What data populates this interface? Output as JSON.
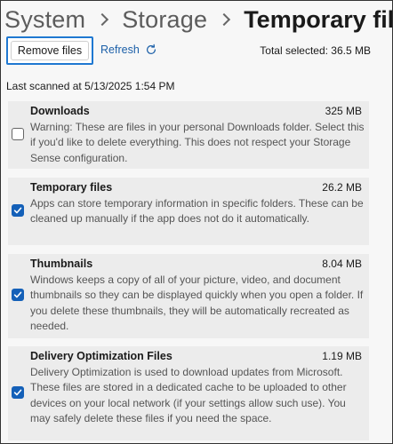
{
  "breadcrumb": {
    "items": [
      "System",
      "Storage"
    ],
    "current": "Temporary files"
  },
  "toolbar": {
    "remove_label": "Remove files",
    "refresh_label": "Refresh",
    "total_selected": "Total selected: 36.5 MB"
  },
  "last_scanned": "Last scanned at 5/13/2025 1:54 PM",
  "categories": [
    {
      "title": "Downloads",
      "size": "325 MB",
      "checked": false,
      "description": "Warning: These are files in your personal Downloads folder. Select this if you'd like to delete everything. This does not respect your Storage Sense configuration."
    },
    {
      "title": "Temporary files",
      "size": "26.2 MB",
      "checked": true,
      "description": "Apps can store temporary information in specific folders. These can be cleaned up manually if the app does not do it automatically."
    },
    {
      "title": "Thumbnails",
      "size": "8.04 MB",
      "checked": true,
      "description": "Windows keeps a copy of all of your picture, video, and document thumbnails so they can be displayed quickly when you open a folder. If you delete these thumbnails, they will be automatically recreated as needed."
    },
    {
      "title": "Delivery Optimization Files",
      "size": "1.19 MB",
      "checked": true,
      "description": "Delivery Optimization is used to download updates from Microsoft. These files are stored in a dedicated cache to be uploaded to other devices on your local network (if your settings allow such use). You may safely delete these files if you need the space."
    }
  ],
  "colors": {
    "accent": "#1460b8",
    "focus_ring": "#1f78d1",
    "link": "#1b5fa8",
    "card_background": "#ececec"
  },
  "icons": {
    "refresh": "refresh-icon",
    "checkmark": "checkmark-icon",
    "chevron": "chevron-right-icon"
  }
}
